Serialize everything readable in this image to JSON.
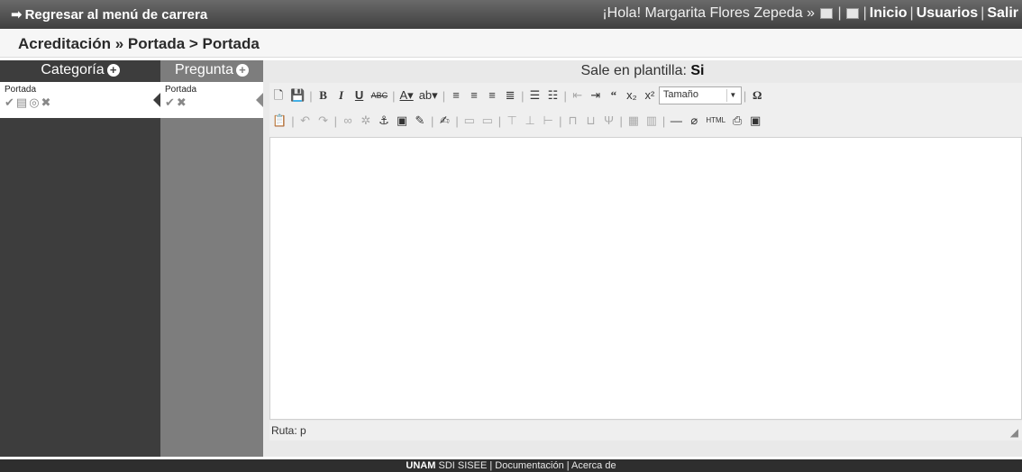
{
  "topbar": {
    "back_label": "Regresar al menú de carrera",
    "greeting": "¡Hola! Margarita Flores Zepeda »",
    "links": [
      "Inicio",
      "Usuarios",
      "Salir"
    ]
  },
  "breadcrumb": "Acreditación » Portada > Portada",
  "categoria": {
    "header": "Categoría",
    "items": [
      {
        "name": "Portada"
      }
    ]
  },
  "pregunta": {
    "header": "Pregunta",
    "items": [
      {
        "name": "Portada"
      }
    ]
  },
  "editor": {
    "plantilla_label": "Sale en plantilla:",
    "plantilla_value": "Si",
    "size_select": "Tamaño",
    "path_label": "Ruta: p"
  },
  "footer": {
    "brand": "UNAM",
    "text": "SDI SISEE | Documentación | Acerca de"
  }
}
